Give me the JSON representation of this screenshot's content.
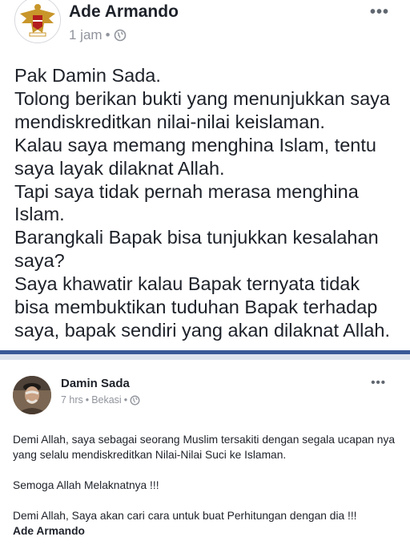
{
  "post1": {
    "author": "Ade Armando",
    "time": "1 jam",
    "separator": "•",
    "more": "•••",
    "body": "Pak Damin Sada.\nTolong berikan bukti yang menunjukkan saya mendiskreditkan nilai-nilai keislaman.\nKalau saya memang menghina Islam, tentu saya layak dilaknat Allah.\nTapi saya tidak pernah merasa menghina Islam.\nBarangkali Bapak bisa tunjukkan kesalahan saya?\nSaya khawatir kalau Bapak ternyata tidak bisa membuktikan tuduhan Bapak terhadap saya, bapak sendiri yang akan dilaknat Allah."
  },
  "post2": {
    "author": "Damin Sada",
    "time": "7 hrs",
    "separator": "•",
    "location": "Bekasi",
    "more": "•••",
    "paragraph1": "Demi Allah, saya sebagai seorang Muslim tersakiti dengan segala ucapan nya yang selalu mendiskreditkan Nilai-Nilai Suci ke Islaman.",
    "paragraph2": "Semoga Allah Melaknatnya !!!",
    "paragraph3": "Demi Allah, Saya akan cari cara untuk buat Perhitungan dengan dia !!!",
    "mention": "Ade Armando"
  },
  "colors": {
    "divider_accent": "#3b5998",
    "meta_gray": "#90949c",
    "text": "#1d2129"
  }
}
